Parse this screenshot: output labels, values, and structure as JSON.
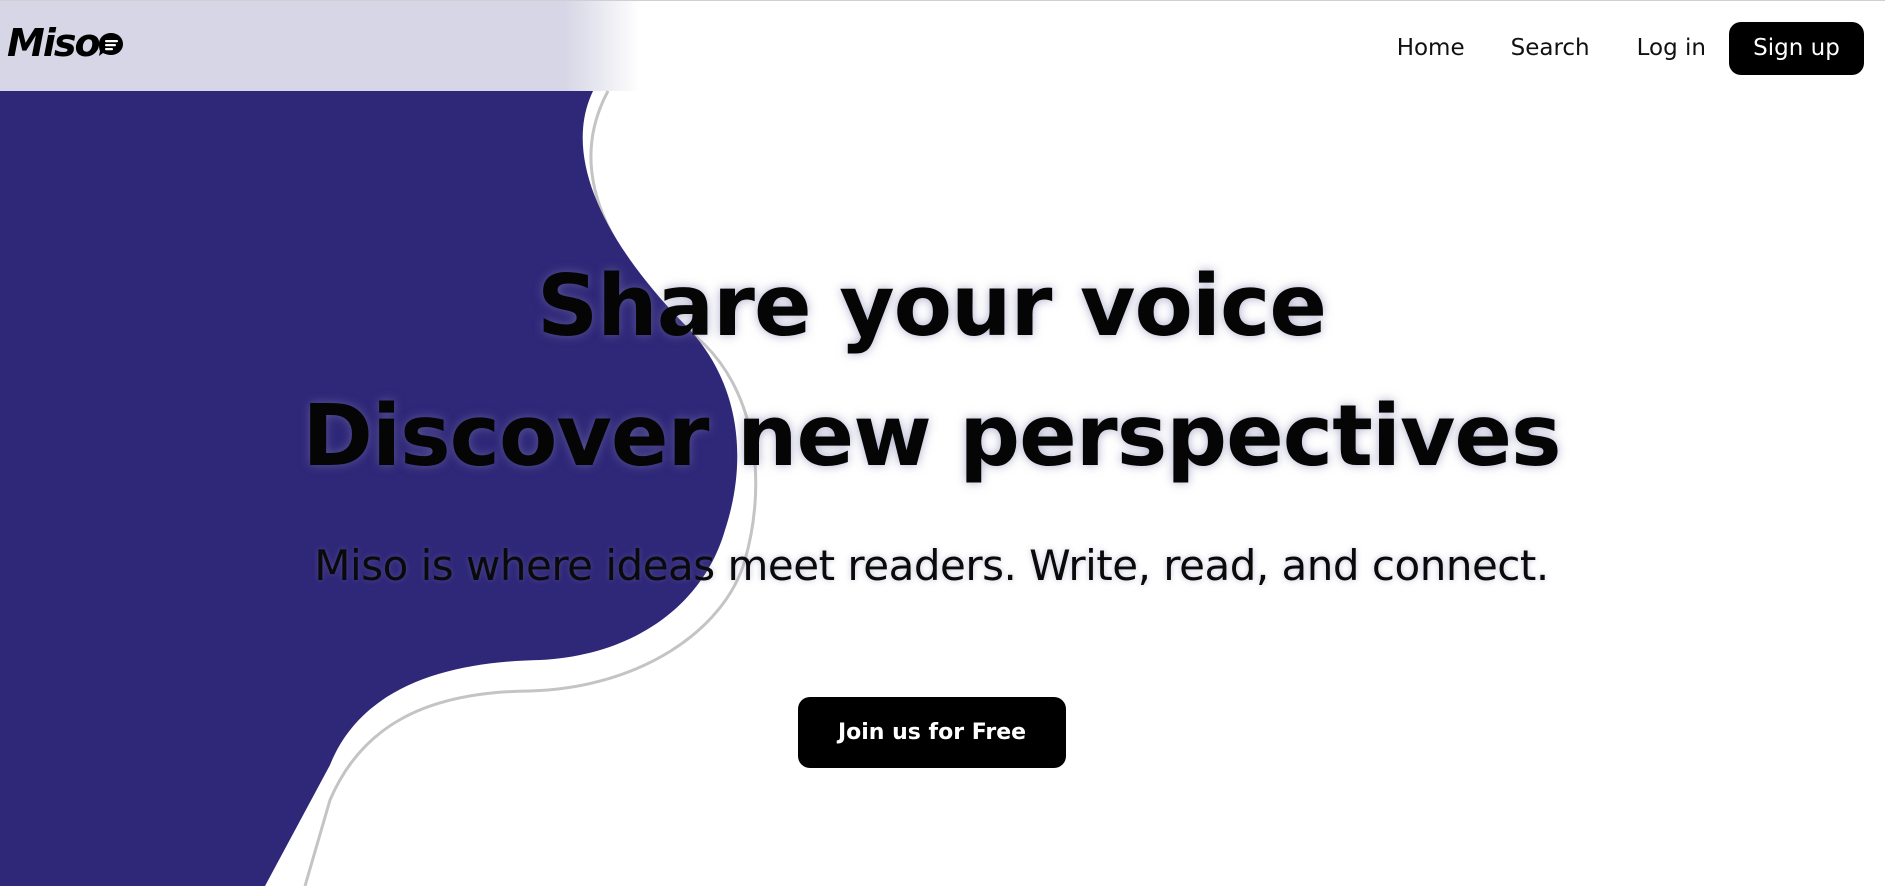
{
  "header": {
    "logo_text": "Miso",
    "logo_icon": "chat-bubble-icon",
    "nav": {
      "home": "Home",
      "search": "Search",
      "login": "Log in",
      "signup": "Sign up"
    }
  },
  "hero": {
    "headline_line1": "Share your voice",
    "headline_line2": "Discover new perspectives",
    "tagline": "Miso is where ideas meet readers. Write, read, and connect.",
    "cta": "Join us for Free"
  },
  "colors": {
    "blob": "#2f2778",
    "nav_tint": "#d6d6e6",
    "button_bg": "#000000",
    "button_text": "#ffffff",
    "outline": "#c4c4c4"
  }
}
